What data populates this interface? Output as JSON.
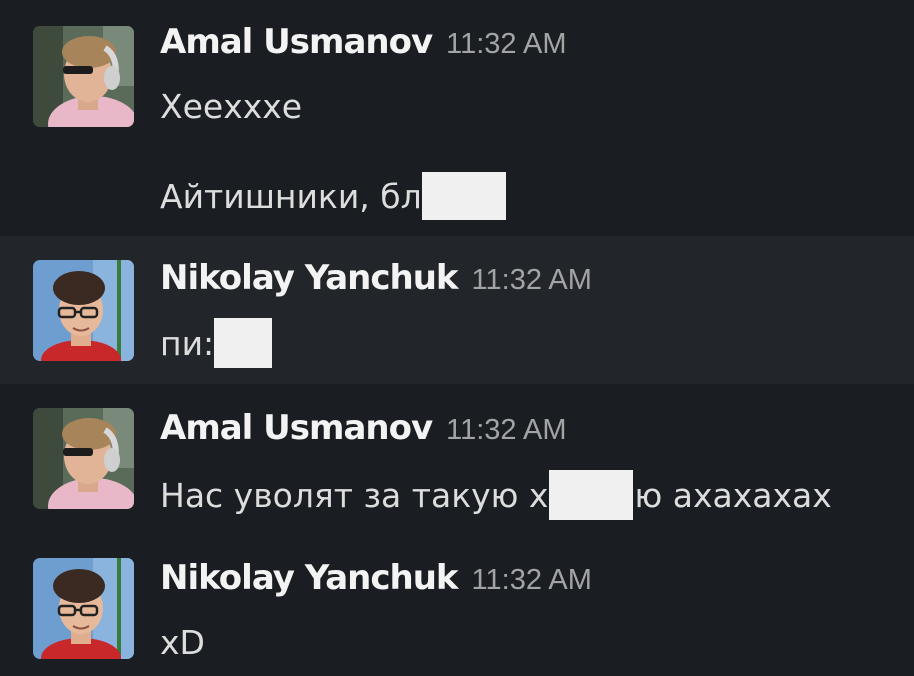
{
  "messages": [
    {
      "author": "Amal Usmanov",
      "time": "11:32 AM",
      "lines": [
        {
          "parts": [
            "Хеехххе"
          ]
        },
        {
          "parts": [
            "Айтишники, бл"
          ],
          "redacted_after": true
        }
      ]
    },
    {
      "author": "Nikolay Yanchuk",
      "time": "11:32 AM",
      "lines": [
        {
          "parts": [
            "пи:"
          ],
          "redacted_after": true
        }
      ]
    },
    {
      "author": "Amal Usmanov",
      "time": "11:32 AM",
      "lines": [
        {
          "before": "Нас уволят за такую х",
          "after": "ю ахахахах"
        }
      ]
    },
    {
      "author": "Nikolay Yanchuk",
      "time": "11:32 AM",
      "lines": [
        {
          "parts": [
            "xD"
          ]
        }
      ]
    }
  ],
  "colors": {
    "background": "#1a1d21",
    "highlight_row": "#222529",
    "author": "#f3f3f3",
    "timestamp": "#a2a3a5",
    "text": "#dcdddd",
    "redaction": "#f0f0f0"
  },
  "icons": {
    "amal_avatar": "avatar-headphones-icon",
    "nikolay_avatar": "avatar-glasses-icon"
  }
}
